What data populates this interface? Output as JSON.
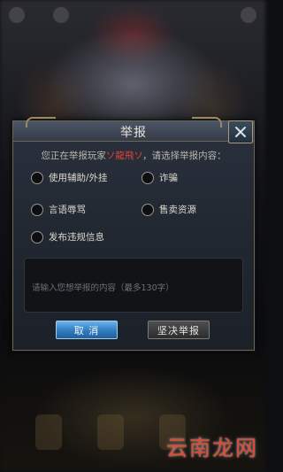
{
  "dialog": {
    "title": "举报",
    "prompt_before": "您正在举报玩家",
    "player_name": "ソ龍飛ソ",
    "prompt_after": "，请选择举报内容：",
    "options": [
      {
        "label": "使用辅助/外挂",
        "selected": false
      },
      {
        "label": "诈骗",
        "selected": false
      },
      {
        "label": "言语辱骂",
        "selected": false
      },
      {
        "label": "售卖资源",
        "selected": false
      },
      {
        "label": "发布违规信息",
        "selected": false
      }
    ],
    "textarea_placeholder": "请输入您想举报的内容（最多130字）",
    "cancel_label": "取 消",
    "confirm_label": "坚决举报"
  },
  "watermark": "云南龙网",
  "colors": {
    "player_name": "#e0423a",
    "cancel_button": "#2f7cc0",
    "confirm_button": "#2c2c2c",
    "frame_gold": "#9a8a63"
  },
  "icons": {
    "close": "close-icon"
  }
}
